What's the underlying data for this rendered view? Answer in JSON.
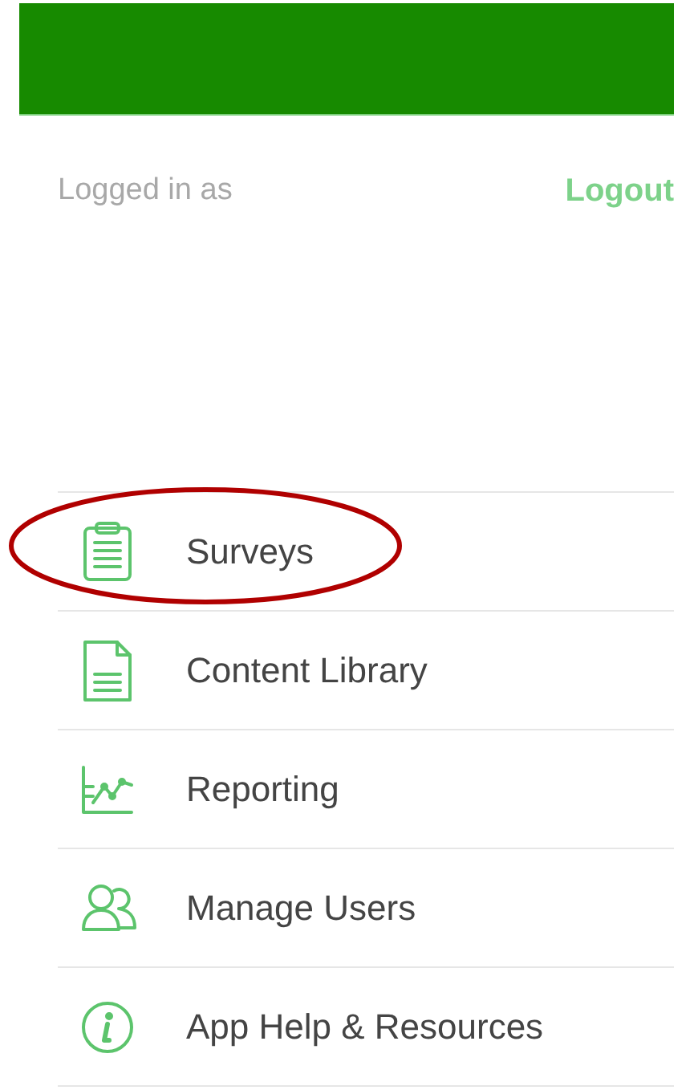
{
  "header": {
    "kind": "banner"
  },
  "account": {
    "logged_in_label": "Logged in as",
    "logout": "Logout"
  },
  "menu": [
    {
      "label": "Surveys",
      "kind": "clipboard",
      "circled": true
    },
    {
      "label": "Content Library",
      "kind": "document",
      "circled": false
    },
    {
      "label": "Reporting",
      "kind": "chart",
      "circled": false
    },
    {
      "label": "Manage Users",
      "kind": "users",
      "circled": false
    },
    {
      "label": "App Help & Resources",
      "kind": "info",
      "circled": false
    }
  ]
}
